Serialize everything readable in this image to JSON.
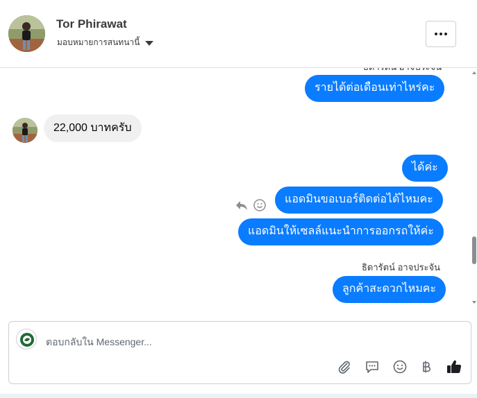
{
  "header": {
    "name": "Tor Phirawat",
    "subtitle": "มอบหมายการสนทนานี้"
  },
  "thread": {
    "partial_sender_label": "ธิดารัตน์ อาจประจัน",
    "messages": [
      {
        "direction": "out",
        "text": "รายได้ต่อเดือนเท่าไหร่คะ"
      },
      {
        "direction": "in",
        "text": "22,000 บาทครับ"
      },
      {
        "direction": "out",
        "text": "ได้ค่ะ"
      },
      {
        "direction": "out",
        "text": "แอดมินขอเบอร์ติดต่อได้ไหมคะ"
      },
      {
        "direction": "out",
        "text": "แอดมินให้เซลล์แนะนำการออกรถให้ค่ะ"
      },
      {
        "direction": "out",
        "text": "ลูกค้าสะดวกไหมคะ"
      }
    ],
    "sender_label": "ธิดารัตน์ อาจประจัน"
  },
  "composer": {
    "placeholder": "ตอบกลับใน Messenger...",
    "value": "",
    "tools": [
      "attach-icon",
      "saved-reply-icon",
      "emoji-icon",
      "baht-icon",
      "thumbs-up-icon"
    ]
  },
  "colors": {
    "accent": "#0a7cff",
    "incoming_bubble": "#f0f0f0"
  }
}
